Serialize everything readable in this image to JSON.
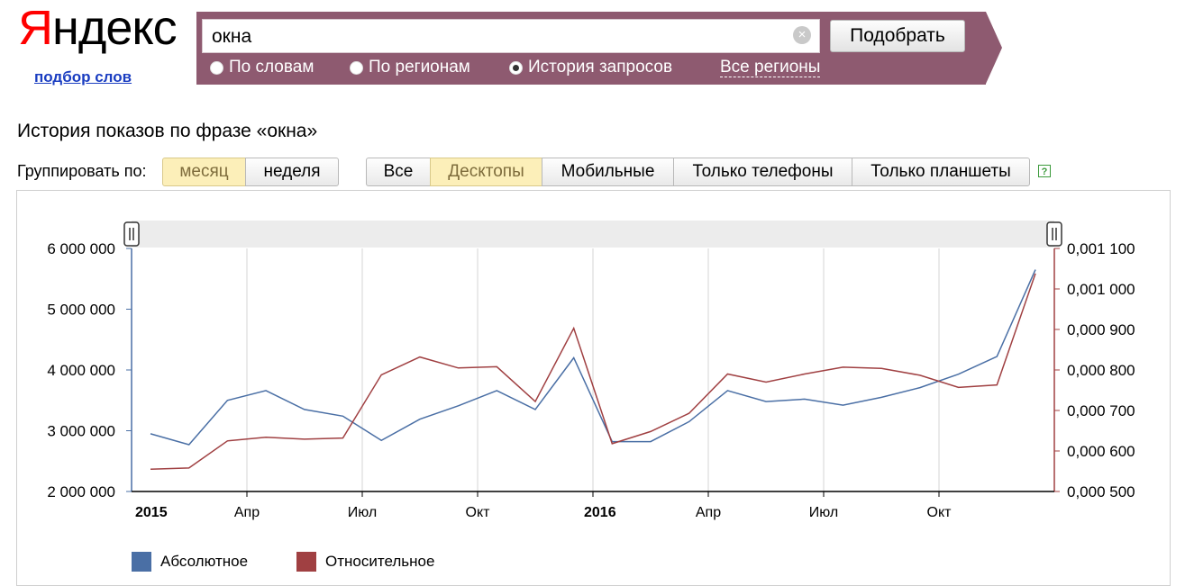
{
  "logo": {
    "first_letter": "Я",
    "rest": "ндекс"
  },
  "logo_sub_link": "подбор слов",
  "search": {
    "value": "окна",
    "clear_icon": "×",
    "submit_label": "Подобрать"
  },
  "modes": [
    {
      "label": "По словам",
      "selected": false
    },
    {
      "label": "По регионам",
      "selected": false
    },
    {
      "label": "История запросов",
      "selected": true
    }
  ],
  "regions_link": "Все регионы",
  "page_title": "История показов по фразе «окна»",
  "group_by": {
    "label": "Группировать по:",
    "options": [
      "месяц",
      "неделя"
    ],
    "selected": "месяц"
  },
  "device_filters": {
    "options": [
      "Все",
      "Десктопы",
      "Мобильные",
      "Только телефоны",
      "Только планшеты"
    ],
    "selected": "Десктопы"
  },
  "help_icon": "?",
  "colors": {
    "panel": "#8e5a70",
    "absolute": "#4a6fa5",
    "relative": "#a04042",
    "active_tab": "#fcefb9"
  },
  "chart_data": {
    "type": "line",
    "x": [
      "2015-01",
      "2015-02",
      "2015-03",
      "2015-04",
      "2015-05",
      "2015-06",
      "2015-07",
      "2015-08",
      "2015-09",
      "2015-10",
      "2015-11",
      "2015-12",
      "2016-01",
      "2016-02",
      "2016-03",
      "2016-04",
      "2016-05",
      "2016-06",
      "2016-07",
      "2016-08",
      "2016-09",
      "2016-10",
      "2016-11",
      "2016-12"
    ],
    "x_tick_labels": [
      "2015",
      "Апр",
      "Июл",
      "Окт",
      "2016",
      "Апр",
      "Июл",
      "Окт"
    ],
    "x_tick_bold": [
      "2015",
      "2016"
    ],
    "series": [
      {
        "name": "Абсолютное",
        "axis": "left",
        "values": [
          2950000,
          2770000,
          3500000,
          3660000,
          3350000,
          3240000,
          2840000,
          3190000,
          3410000,
          3660000,
          3350000,
          4200000,
          2820000,
          2820000,
          3150000,
          3660000,
          3480000,
          3520000,
          3420000,
          3550000,
          3710000,
          3930000,
          4220000,
          5650000
        ]
      },
      {
        "name": "Относительное",
        "axis": "right",
        "values": [
          0.000555,
          0.000558,
          0.000625,
          0.000634,
          0.000629,
          0.000632,
          0.000788,
          0.000832,
          0.000805,
          0.000808,
          0.000722,
          0.000903,
          0.000618,
          0.000648,
          0.000693,
          0.00079,
          0.00077,
          0.00079,
          0.000807,
          0.000804,
          0.000787,
          0.000757,
          0.000763,
          0.001038
        ]
      }
    ],
    "y_left": {
      "lim": [
        2000000,
        6000000
      ],
      "ticks": [
        2000000,
        3000000,
        4000000,
        5000000,
        6000000
      ],
      "tick_labels": [
        "2 000 000",
        "3 000 000",
        "4 000 000",
        "5 000 000",
        "6 000 000"
      ]
    },
    "y_right": {
      "lim": [
        0.0005,
        0.0011
      ],
      "ticks": [
        0.0005,
        0.0006,
        0.0007,
        0.0008,
        0.0009,
        0.001,
        0.0011
      ],
      "tick_labels": [
        "0,000 500",
        "0,000 600",
        "0,000 700",
        "0,000 800",
        "0,000 900",
        "0,001 000",
        "0,001 100"
      ]
    },
    "grid": "vertical",
    "legend_position": "bottom-left"
  }
}
